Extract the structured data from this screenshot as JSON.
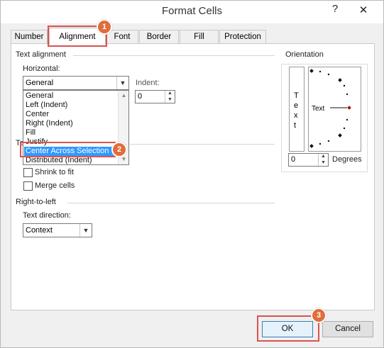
{
  "window": {
    "title": "Format Cells",
    "help_glyph": "?",
    "close_glyph": "✕"
  },
  "tabs": [
    {
      "label": "Number"
    },
    {
      "label": "Alignment"
    },
    {
      "label": "Font"
    },
    {
      "label": "Border"
    },
    {
      "label": "Fill"
    },
    {
      "label": "Protection"
    }
  ],
  "text_alignment": {
    "group_label": "Text alignment",
    "horizontal_label": "Horizontal:",
    "horizontal_value": "General",
    "horizontal_options": [
      "General",
      "Left (Indent)",
      "Center",
      "Right (Indent)",
      "Fill",
      "Justify",
      "Center Across Selection",
      "Distributed (Indent)"
    ],
    "selected_option": "Center Across Selection",
    "indent_label": "Indent:",
    "indent_value": "0"
  },
  "text_control": {
    "group_label_partial": "Te",
    "shrink_to_fit": "Shrink to fit",
    "merge_cells": "Merge cells"
  },
  "right_to_left": {
    "group_label": "Right-to-left",
    "direction_label": "Text direction:",
    "direction_value": "Context"
  },
  "orientation": {
    "group_label": "Orientation",
    "vertical_letters": [
      "T",
      "e",
      "x",
      "t"
    ],
    "dial_label": "Text",
    "degrees_value": "0",
    "degrees_label": "Degrees"
  },
  "buttons": {
    "ok": "OK",
    "cancel": "Cancel"
  },
  "annotations": [
    "1",
    "2",
    "3"
  ],
  "colors": {
    "callout": "#d9534f",
    "badge": "#e06d3c",
    "selection": "#3399ff"
  }
}
